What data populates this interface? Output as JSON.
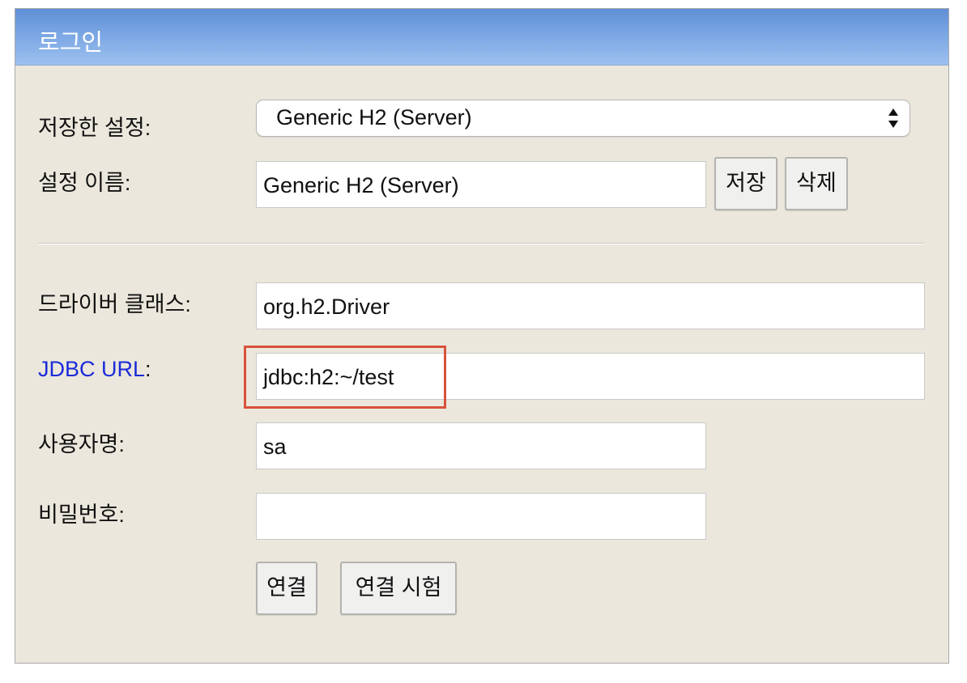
{
  "window": {
    "title": "로그인"
  },
  "saved_settings": {
    "label": "저장한 설정:",
    "selected": "Generic H2 (Server)"
  },
  "setting_name": {
    "label": "설정 이름:",
    "value": "Generic H2 (Server)",
    "save_button": "저장",
    "delete_button": "삭제"
  },
  "driver_class": {
    "label": "드라이버 클래스:",
    "value": "org.h2.Driver"
  },
  "jdbc_url": {
    "link_text": "JDBC URL",
    "colon": ":",
    "value": "jdbc:h2:~/test"
  },
  "username": {
    "label": "사용자명:",
    "value": "sa"
  },
  "password": {
    "label": "비밀번호:",
    "value": ""
  },
  "actions": {
    "connect_button": "연결",
    "test_connection_button": "연결 시험"
  },
  "colors": {
    "title_bar": "#7aa6e3",
    "panel_background": "#ebe7dc",
    "link": "#1a2bd8",
    "highlight": "#d9513c"
  }
}
